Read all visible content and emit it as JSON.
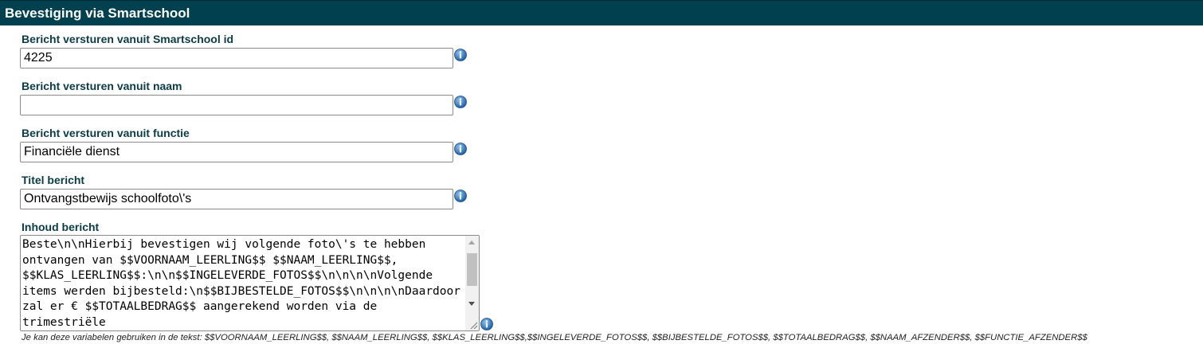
{
  "section": {
    "title": "Bevestiging via Smartschool"
  },
  "fields": {
    "sender_id": {
      "label": "Bericht versturen vanuit Smartschool id",
      "value": "4225"
    },
    "sender_name": {
      "label": "Bericht versturen vanuit naam",
      "value": ""
    },
    "sender_function": {
      "label": "Bericht versturen vanuit functie",
      "value": "Financiële dienst"
    },
    "message_title": {
      "label": "Titel bericht",
      "value": "Ontvangstbewijs schoolfoto\\'s"
    },
    "message_body": {
      "label": "Inhoud bericht",
      "value": "Beste\\n\\nHierbij bevestigen wij volgende foto\\'s te hebben ontvangen van $$VOORNAAM_LEERLING$$ $$NAAM_LEERLING$$, $$KLAS_LEERLING$$:\\n\\n$$INGELEVERDE_FOTOS$$\\n\\n\\n\\nVolgende items werden bijbesteld:\\n$$BIJBESTELDE_FOTOS$$\\n\\n\\n\\nDaardoor zal er € $$TOTAALBEDRAG$$ aangerekend worden via de trimestriële"
    }
  },
  "hint": "Je kan deze variabelen gebruiken in de tekst: $$VOORNAAM_LEERLING$$, $$NAAM_LEERLING$$, $$KLAS_LEERLING$$,$$INGELEVERDE_FOTOS$$, $$BIJBESTELDE_FOTOS$$, $$TOTAALBEDRAG$$, $$NAAM_AFZENDER$$, $$FUNCTIE_AFZENDER$$",
  "icons": {
    "info": "info-icon"
  },
  "colors": {
    "header_bg": "#01404f",
    "label": "#0b3c46",
    "info_icon": "#2e6fb8"
  }
}
